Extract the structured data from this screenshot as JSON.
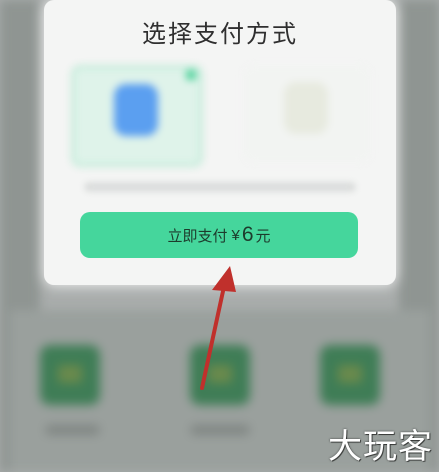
{
  "dialog": {
    "title": "选择支付方式",
    "pay_button": {
      "label": "立即支付",
      "currency": "¥",
      "amount": "6",
      "unit": "元"
    }
  },
  "payment_options": [
    {
      "name": "alipay",
      "selected": true
    },
    {
      "name": "wechat-pay",
      "selected": false
    }
  ],
  "annotation": {
    "arrow_color": "#c0302c"
  },
  "watermark": "大玩客",
  "colors": {
    "accent": "#45d69c",
    "sheet": "#f4f5f4"
  }
}
